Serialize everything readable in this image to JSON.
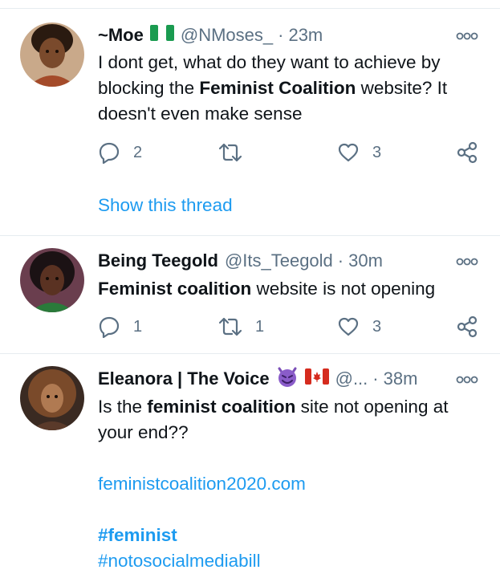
{
  "tweets": [
    {
      "name": "~Moe",
      "flag": "nigeria",
      "handle": "@NMoses_",
      "separator": "·",
      "time": "23m",
      "text_parts": [
        "I dont get, what do they want to achieve by blocking the ",
        "Feminist Coalition",
        " website? It doesn't even make sense"
      ],
      "reply_count": "2",
      "retweet_count": "",
      "like_count": "3",
      "show_thread": "Show this thread"
    },
    {
      "name": "Being Teegold",
      "handle": "@Its_Teegold",
      "separator": "·",
      "time": "30m",
      "text_parts": [
        "Feminist coalition",
        " website is not opening"
      ],
      "reply_count": "1",
      "retweet_count": "1",
      "like_count": "3"
    },
    {
      "name": "Eleanora | The Voice",
      "emoji": "smiling-devil",
      "flag": "canada",
      "handle": "@...",
      "separator": "·",
      "time": "38m",
      "text_parts": [
        "Is the ",
        "feminist coalition",
        " site not opening at your end??"
      ],
      "link": "feministcoalition2020.com",
      "hashtags": [
        "#feminist",
        "#notosocialmediabill"
      ]
    }
  ],
  "icons": {
    "reply": "reply-icon",
    "retweet": "retweet-icon",
    "like": "heart-icon",
    "share": "share-icon",
    "more": "more-options-icon"
  },
  "colors": {
    "text": "#0f1419",
    "muted": "#5b7083",
    "link": "#1d9bf0",
    "divider": "#e6ecf0"
  }
}
